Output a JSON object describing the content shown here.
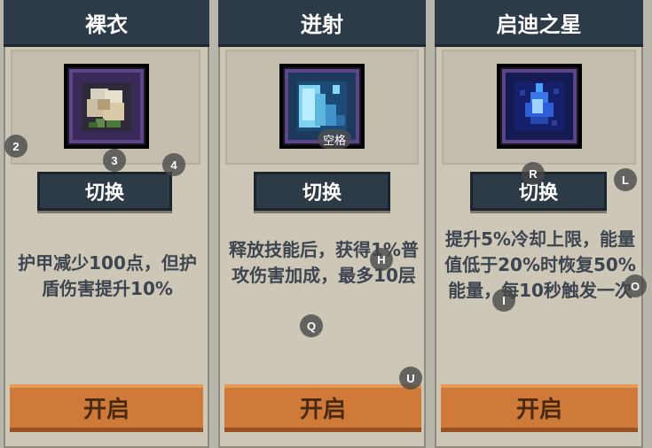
{
  "cards": [
    {
      "title": "裸衣",
      "icon": "flower-icon",
      "switch_label": "切换",
      "description": "护甲减少100点，但护盾伤害提升10%",
      "open_label": "开启"
    },
    {
      "title": "迸射",
      "icon": "burst-icon",
      "key_hint": "空格",
      "switch_label": "切换",
      "description": "释放技能后，获得1%普攻伤害加成，最多10层",
      "open_label": "开启"
    },
    {
      "title": "启迪之星",
      "icon": "blue-star-gem-icon",
      "switch_label": "切换",
      "description": "提升5%冷却上限，能量值低于20%时恢复50%能量，每10秒触发一次",
      "open_label": "开启"
    }
  ],
  "markers": [
    "2",
    "3",
    "4",
    "H",
    "Q",
    "U",
    "R",
    "L",
    "O",
    "I"
  ],
  "colors": {
    "header": "#2c3b47",
    "panel": "#ccc7b7",
    "open_button": "#cf7a38",
    "description_text": "#3e4450"
  }
}
